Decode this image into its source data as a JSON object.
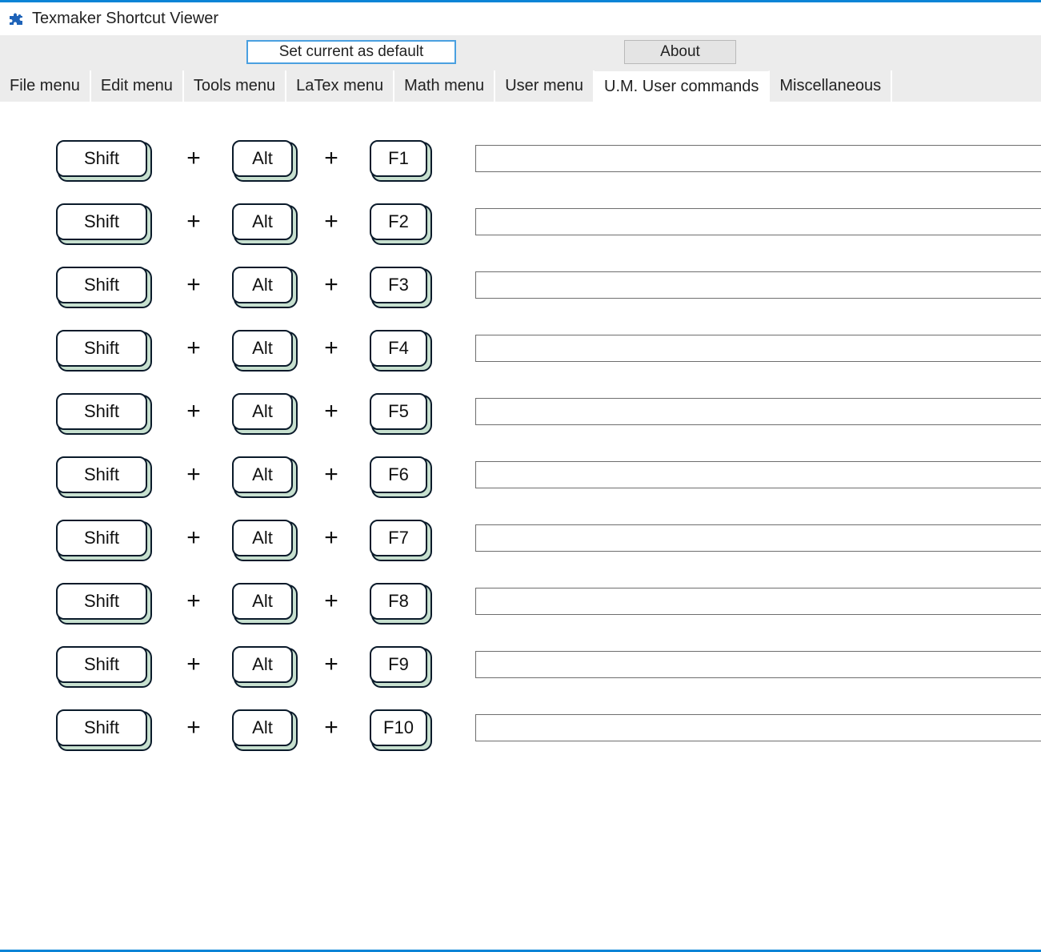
{
  "window": {
    "title": "Texmaker Shortcut Viewer"
  },
  "toolbar": {
    "set_default_label": "Set current as default",
    "about_label": "About"
  },
  "tabs": [
    {
      "label": "File menu",
      "active": false
    },
    {
      "label": "Edit menu",
      "active": false
    },
    {
      "label": "Tools menu",
      "active": false
    },
    {
      "label": "LaTex menu",
      "active": false
    },
    {
      "label": "Math menu",
      "active": false
    },
    {
      "label": "User menu",
      "active": false
    },
    {
      "label": "U.M. User commands",
      "active": true
    },
    {
      "label": "Miscellaneous",
      "active": false
    }
  ],
  "shortcuts": [
    {
      "keys": [
        "Shift",
        "Alt",
        "F1"
      ],
      "value": ""
    },
    {
      "keys": [
        "Shift",
        "Alt",
        "F2"
      ],
      "value": ""
    },
    {
      "keys": [
        "Shift",
        "Alt",
        "F3"
      ],
      "value": ""
    },
    {
      "keys": [
        "Shift",
        "Alt",
        "F4"
      ],
      "value": ""
    },
    {
      "keys": [
        "Shift",
        "Alt",
        "F5"
      ],
      "value": ""
    },
    {
      "keys": [
        "Shift",
        "Alt",
        "F6"
      ],
      "value": ""
    },
    {
      "keys": [
        "Shift",
        "Alt",
        "F7"
      ],
      "value": ""
    },
    {
      "keys": [
        "Shift",
        "Alt",
        "F8"
      ],
      "value": ""
    },
    {
      "keys": [
        "Shift",
        "Alt",
        "F9"
      ],
      "value": ""
    },
    {
      "keys": [
        "Shift",
        "Alt",
        "F10"
      ],
      "value": ""
    }
  ],
  "plus_symbol": "+"
}
